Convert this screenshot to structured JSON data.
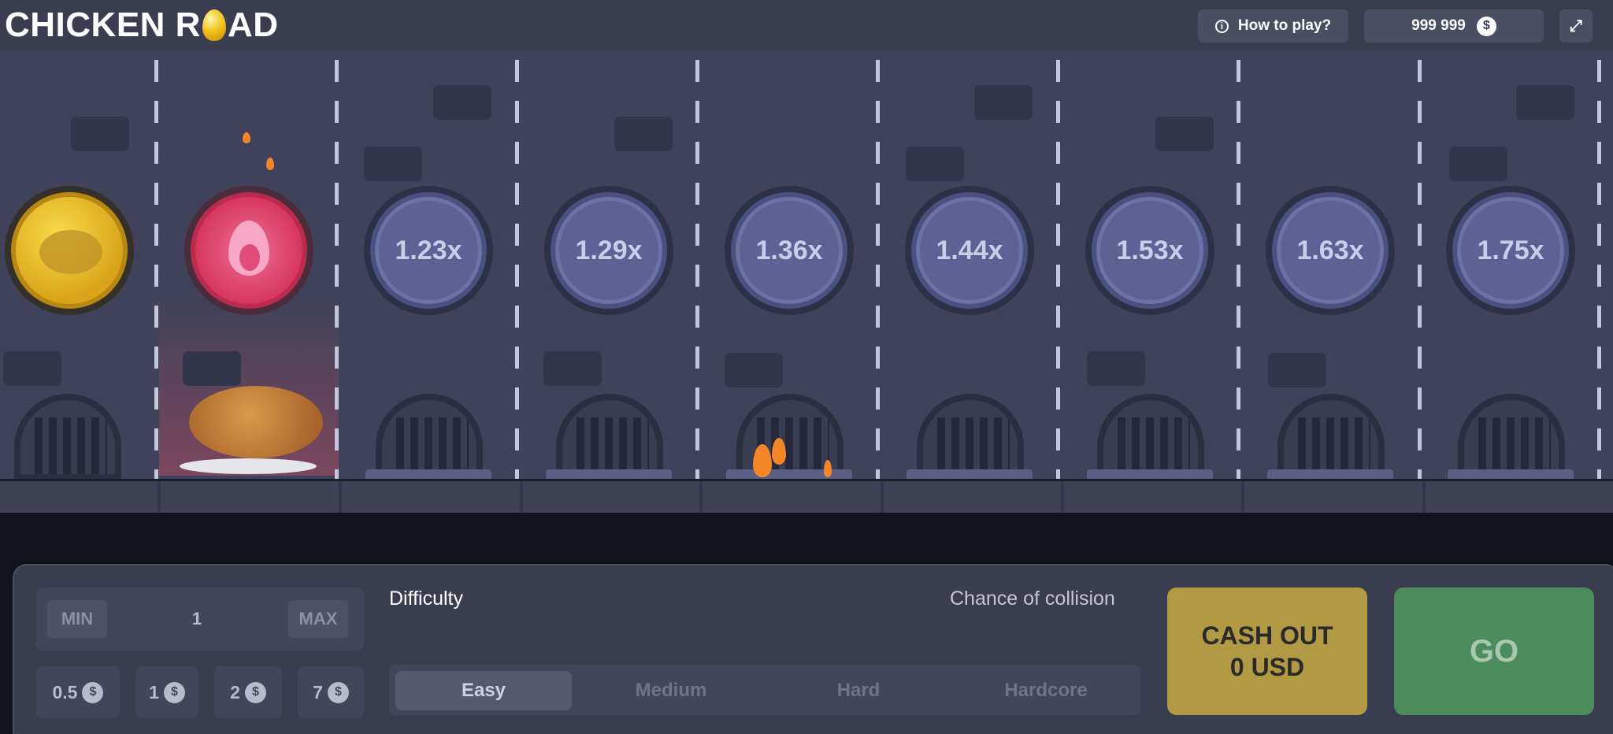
{
  "header": {
    "logo_part1": "CHICKEN R",
    "logo_part2": "AD",
    "how_to_play": "How to play?",
    "balance": "999 999",
    "currency_icon": "dollar-icon",
    "fullscreen_icon": "fullscreen-icon"
  },
  "lanes": {
    "multipliers": [
      "1.23x",
      "1.29x",
      "1.36x",
      "1.44x",
      "1.53x",
      "1.63x",
      "1.75x"
    ]
  },
  "bet": {
    "min_label": "MIN",
    "max_label": "MAX",
    "value": "1",
    "chips": [
      "0.5",
      "1",
      "2",
      "7"
    ]
  },
  "difficulty": {
    "label": "Difficulty",
    "chance_label": "Chance of collision",
    "options": [
      "Easy",
      "Medium",
      "Hard",
      "Hardcore"
    ],
    "selected": "Easy"
  },
  "actions": {
    "cashout_line1": "CASH OUT",
    "cashout_line2": "0 USD",
    "go": "GO"
  },
  "colors": {
    "cashout": "#b29a45",
    "go": "#4c8c5c",
    "multiplier_coin": "#5c6394",
    "header": "#3a3d4f"
  }
}
